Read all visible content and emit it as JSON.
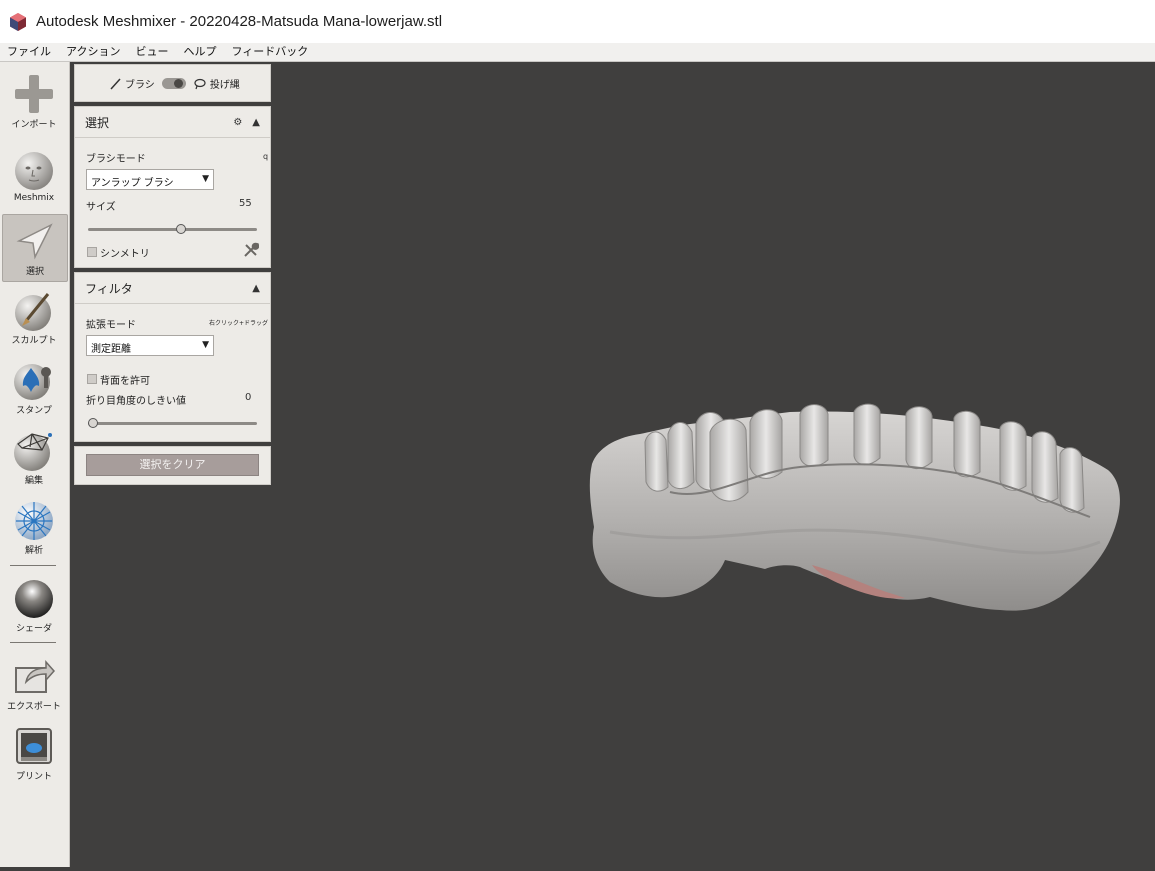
{
  "window": {
    "title": "Autodesk Meshmixer - 20220428-Matsuda Mana-lowerjaw.stl"
  },
  "menu": [
    "ファイル",
    "アクション",
    "ビュー",
    "ヘルプ",
    "フィードバック"
  ],
  "tools": [
    {
      "label": "インポート",
      "icon": "plus-icon"
    },
    {
      "label": "Meshmix",
      "icon": "face-sphere-icon"
    },
    {
      "label": "選択",
      "icon": "select-arrow-icon",
      "active": true
    },
    {
      "label": "スカルプト",
      "icon": "brush-sphere-icon"
    },
    {
      "label": "スタンプ",
      "icon": "stamp-icon"
    },
    {
      "label": "編集",
      "icon": "edit-mesh-icon"
    },
    {
      "label": "解析",
      "icon": "analysis-icon"
    },
    {
      "label": "シェーダ",
      "icon": "shader-sphere-icon"
    },
    {
      "label": "エクスポート",
      "icon": "export-icon"
    },
    {
      "label": "プリント",
      "icon": "print-icon"
    }
  ],
  "mode_toggle": {
    "brush_label": "ブラシ",
    "lasso_label": "投げ縄"
  },
  "select_panel": {
    "title": "選択",
    "brush_mode_label": "ブラシモード",
    "hotkey": "q",
    "brush_mode_value": "アンラップ ブラシ",
    "size_label": "サイズ",
    "size_value": "55",
    "size_fraction": 0.55,
    "symmetry_label": "シンメトリ"
  },
  "filter_panel": {
    "title": "フィルタ",
    "expand_mode_label": "拡張モード",
    "expand_hint": "右クリック+ドラッグ",
    "expand_mode_value": "測定距離",
    "backface_label": "背面を許可",
    "crease_label": "折り目角度のしきい値",
    "crease_value": "0",
    "crease_fraction": 0
  },
  "clear_button": {
    "label": "選択をクリア"
  },
  "colors": {
    "viewport_bg": "#403f3e",
    "panel_bg": "#edebe7",
    "clear_button": "#a79d9b",
    "selection": "#b4827e"
  }
}
